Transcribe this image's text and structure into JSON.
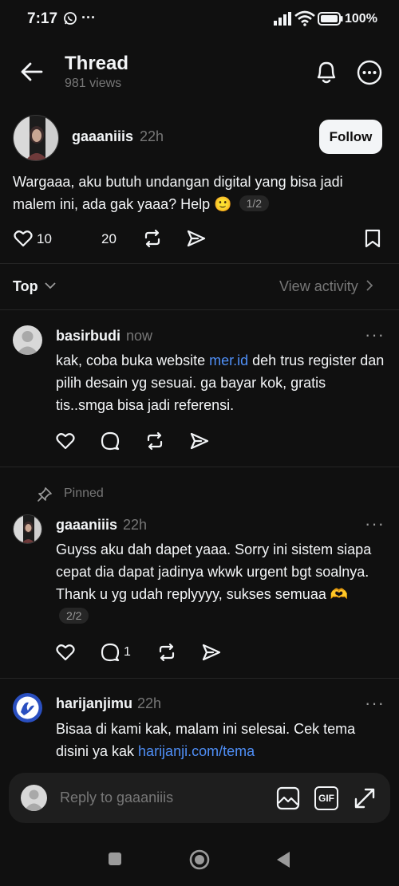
{
  "status_bar": {
    "time": "7:17",
    "ellipsis": "···",
    "battery": "100%"
  },
  "header": {
    "title": "Thread",
    "views": "981 views"
  },
  "post": {
    "username": "gaaaniiis",
    "time": "22h",
    "follow_label": "Follow",
    "text": "Wargaaa, aku butuh undangan digital yang bisa jadi malem ini, ada gak yaaa? Help 🙂",
    "page_badge": "1/2",
    "likes": "10",
    "reposts": "20"
  },
  "sort": {
    "label": "Top",
    "view_activity": "View activity"
  },
  "replies": [
    {
      "username": "basirbudi",
      "time": "now",
      "text_before": "kak, coba buka website ",
      "link": "mer.id",
      "text_after": " deh trus register dan pilih desain yg sesuai. ga bayar kok, gratis tis..smga bisa jadi referensi."
    },
    {
      "pinned_label": "Pinned",
      "username": "gaaaniiis",
      "time": "22h",
      "text": "Guyss aku dah dapet yaaa. Sorry ini sistem siapa cepat dia dapat jadinya wkwk urgent bgt soalnya. Thank u yg udah replyyyy, sukses semuaa 🫶",
      "page_badge": "2/2",
      "comments": "1"
    },
    {
      "username": "harijanjimu",
      "time": "22h",
      "text_before": "Bisaa di kami kak, malam ini selesai. Cek tema disini ya kak ",
      "link": "harijanji.com/tema"
    }
  ],
  "reply_bar": {
    "placeholder": "Reply to gaaaniiis",
    "gif_label": "GIF"
  },
  "colors": {
    "background": "#101010",
    "text": "#f3f5f7",
    "muted": "#777777",
    "link": "#4f8ff7",
    "divider": "#262626"
  }
}
